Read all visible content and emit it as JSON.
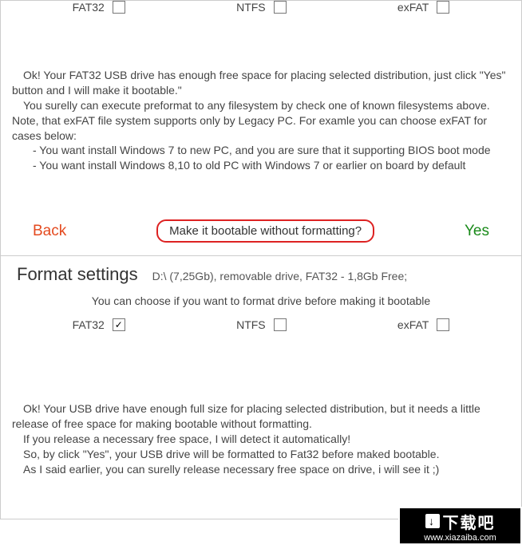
{
  "panel1": {
    "filesystems": [
      {
        "label": "FAT32",
        "checked": false
      },
      {
        "label": "NTFS",
        "checked": false
      },
      {
        "label": "exFAT",
        "checked": false
      }
    ],
    "text_p1": "Ok! Your FAT32 USB drive has enough free space for placing selected distribution, just click \"Yes\" button and I will make it bootable.\"",
    "text_p2": "You surelly can execute preformat to any filesystem by check one of known filesystems above. Note, that exFAT file system supports only by Legacy PC. For examle you can choose exFAT for cases below:",
    "text_li1": "- You want install Windows 7 to new PC, and you are sure that it supporting BIOS boot mode",
    "text_li2": "- You want install Windows 8,10 to old PC with Windows 7 or earlier on board by default",
    "actions": {
      "back": "Back",
      "middle": "Make it bootable without formatting?",
      "yes": "Yes"
    }
  },
  "panel2": {
    "title": "Format settings",
    "subtitle": "D:\\ (7,25Gb), removable drive, FAT32 - 1,8Gb Free;",
    "choose_text": "You can choose if you want to format drive before making it bootable",
    "filesystems": [
      {
        "label": "FAT32",
        "checked": true
      },
      {
        "label": "NTFS",
        "checked": false
      },
      {
        "label": "exFAT",
        "checked": false
      }
    ],
    "text_p1": "Ok! Your USB drive have enough full size for placing selected distribution, but it needs a little release of free space for making bootable without formatting.",
    "text_p2": "If you release a necessary free space, I will detect it automatically!",
    "text_p3": "So, by click \"Yes\", your USB drive will be formatted to Fat32 before maked bootable.",
    "text_p4": "As I said earlier, you can surelly release necessary free space on drive, i will see it ;)"
  },
  "watermark": {
    "main": "下载吧",
    "sub": "www.xiazaiba.com"
  }
}
